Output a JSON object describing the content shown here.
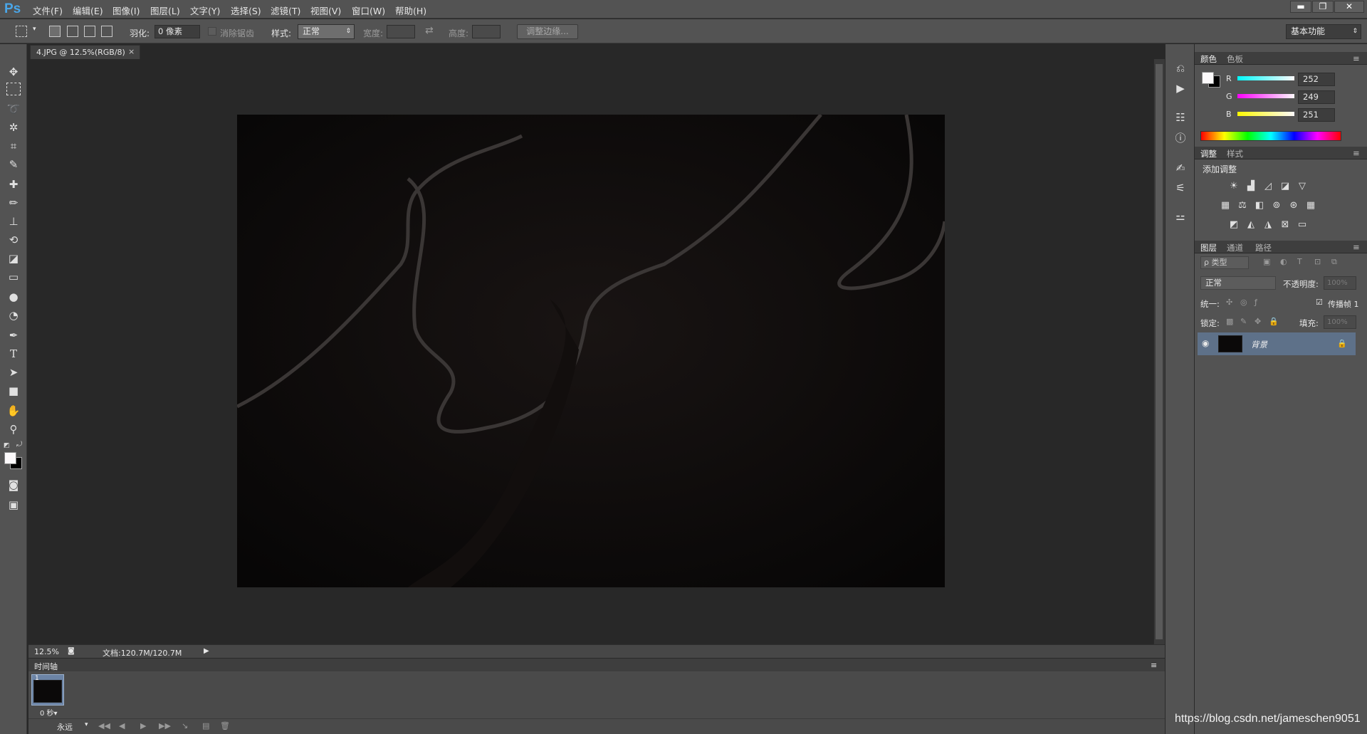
{
  "app": {
    "logo": "Ps"
  },
  "menu": [
    "文件(F)",
    "编辑(E)",
    "图像(I)",
    "图层(L)",
    "文字(Y)",
    "选择(S)",
    "滤镜(T)",
    "视图(V)",
    "窗口(W)",
    "帮助(H)"
  ],
  "window_controls": {
    "minimize": "▬",
    "restore": "❐",
    "close": "✕"
  },
  "options": {
    "feather_label": "羽化:",
    "feather_value": "0 像素",
    "antialias_label": "消除锯齿",
    "style_label": "样式:",
    "style_value": "正常",
    "width_label": "宽度:",
    "height_label": "高度:",
    "refine_edge": "调整边缘...",
    "workspace": "基本功能"
  },
  "document": {
    "tab_title": "4.JPG @ 12.5%(RGB/8)",
    "close": "×",
    "zoom": "12.5%",
    "doc_size": "文档:120.7M/120.7M"
  },
  "timeline": {
    "title": "时间轴",
    "frame_number": "1",
    "frame_delay": "0 秒▾",
    "loop": "永远"
  },
  "color_panel": {
    "tabs": [
      "颜色",
      "色板"
    ],
    "r_label": "R",
    "g_label": "G",
    "b_label": "B",
    "r": "252",
    "g": "249",
    "b": "251"
  },
  "adjust_panel": {
    "tabs": [
      "调整",
      "样式"
    ],
    "title": "添加调整"
  },
  "layers_panel": {
    "tabs": [
      "图层",
      "通道",
      "路径"
    ],
    "filter": "ρ 类型",
    "blend": "正常",
    "opacity_label": "不透明度:",
    "opacity_value": "100%",
    "unify_label": "统一:",
    "propagate_label": "传播帧 1",
    "lock_label": "锁定:",
    "fill_label": "填充:",
    "fill_value": "100%",
    "layer_name": "背景"
  },
  "watermark": "https://blog.csdn.net/jameschen9051",
  "colors": {
    "accent": "#4aa6e8",
    "panel": "#535353",
    "canvas_bg": "#282828",
    "layer_selected": "#5e7189"
  }
}
